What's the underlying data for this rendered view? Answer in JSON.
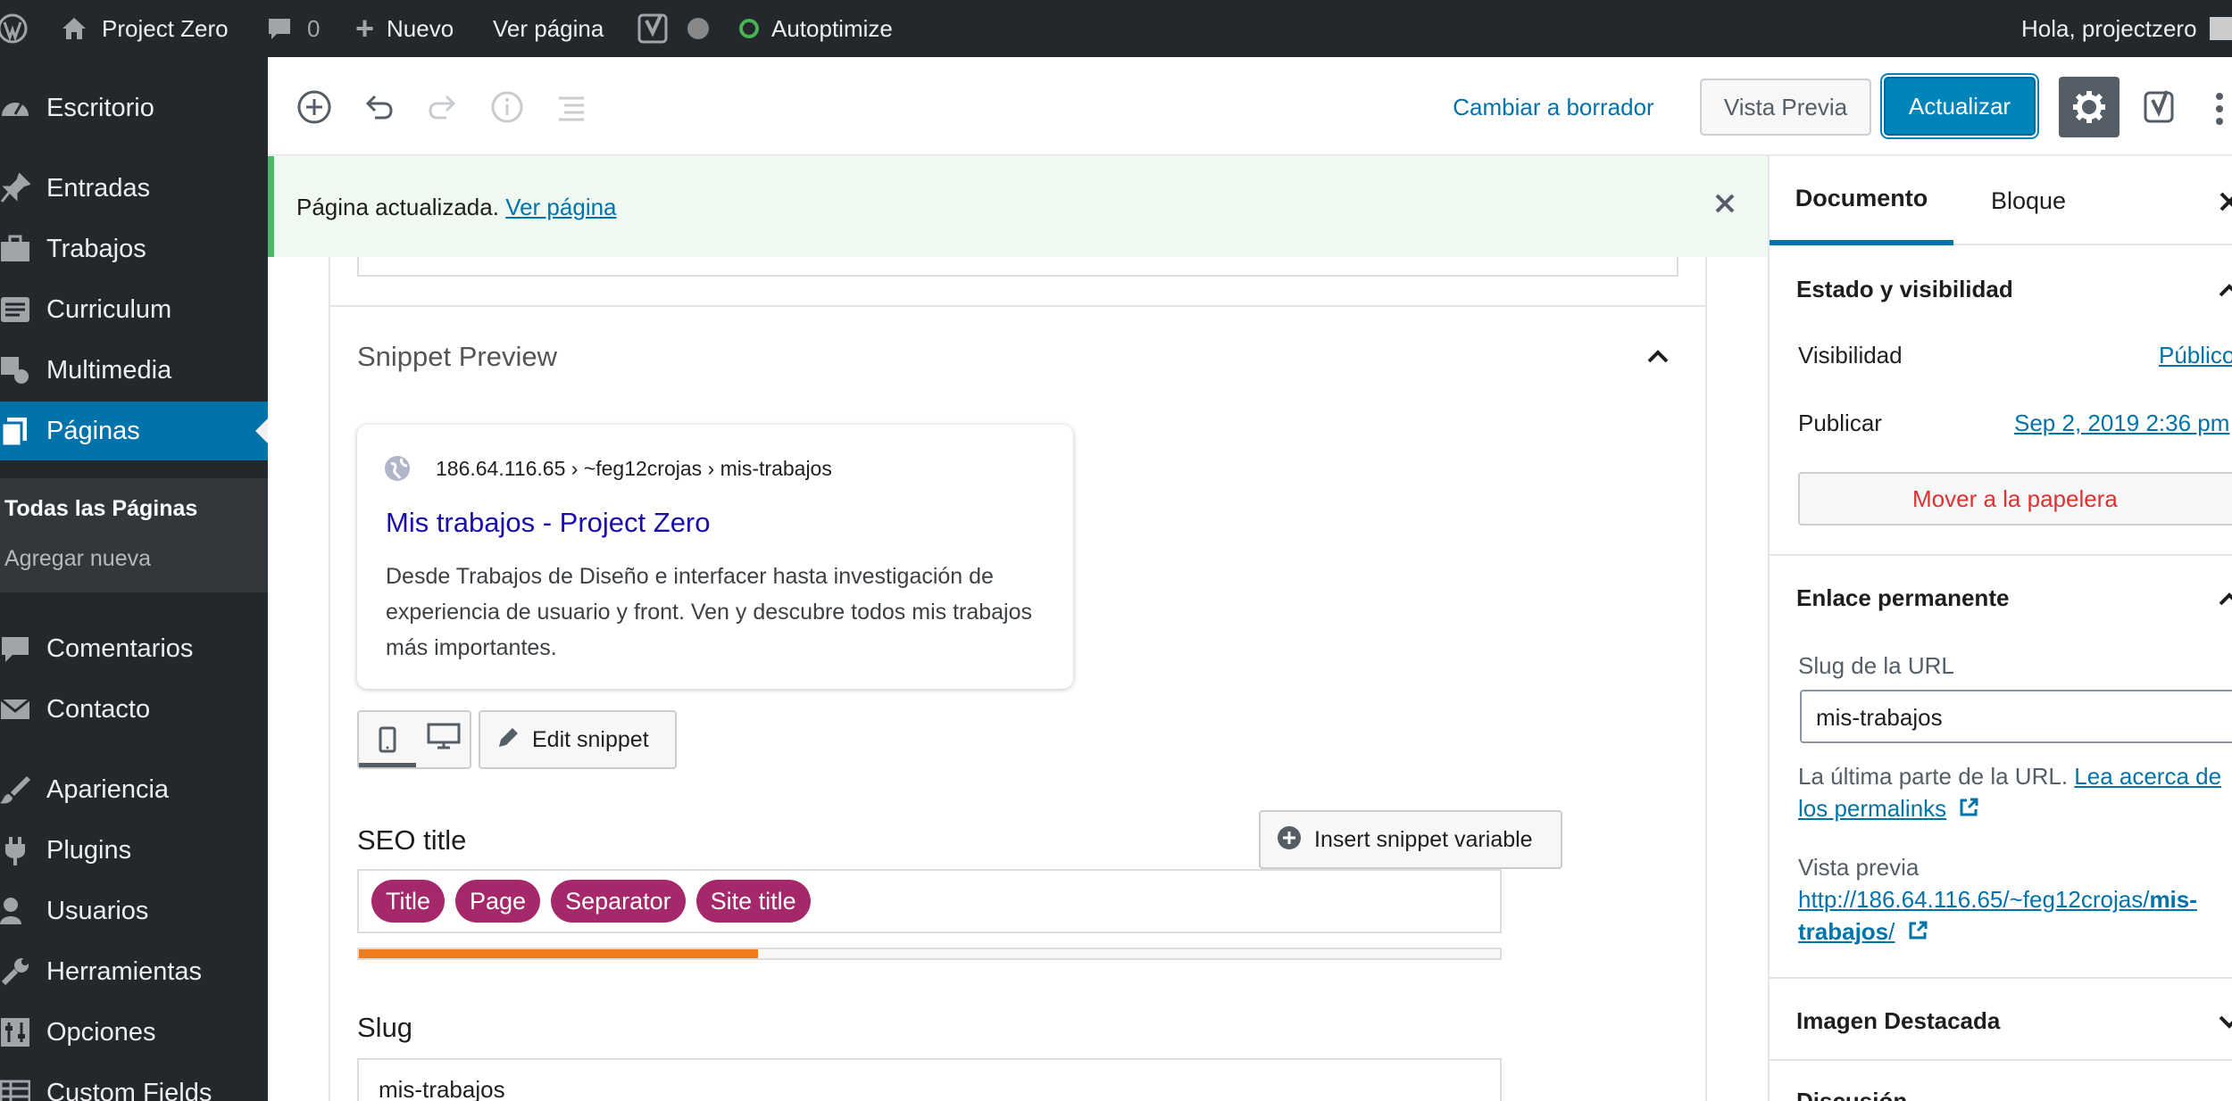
{
  "admin_bar": {
    "site_name": "Project Zero",
    "comments_count": "0",
    "new_label": "Nuevo",
    "view_page_label": "Ver página",
    "autoptimize_label": "Autoptimize",
    "greeting": "Hola, projectzero"
  },
  "menu": {
    "items": [
      {
        "label": "Escritorio",
        "icon": "dashboard-icon"
      },
      {
        "label": "Entradas",
        "icon": "pin-icon"
      },
      {
        "label": "Trabajos",
        "icon": "briefcase-icon"
      },
      {
        "label": "Curriculum",
        "icon": "document-lines-icon"
      },
      {
        "label": "Multimedia",
        "icon": "media-icon"
      },
      {
        "label": "Páginas",
        "icon": "pages-icon"
      },
      {
        "label": "Comentarios",
        "icon": "comment-icon"
      },
      {
        "label": "Contacto",
        "icon": "mail-icon"
      },
      {
        "label": "Apariencia",
        "icon": "brush-icon"
      },
      {
        "label": "Plugins",
        "icon": "plug-icon"
      },
      {
        "label": "Usuarios",
        "icon": "user-icon"
      },
      {
        "label": "Herramientas",
        "icon": "wrench-icon"
      },
      {
        "label": "Opciones",
        "icon": "settings-sliders-icon"
      },
      {
        "label": "Custom Fields",
        "icon": "table-icon"
      }
    ],
    "submenu": {
      "all_pages": "Todas las Páginas",
      "add_new": "Agregar nueva"
    }
  },
  "header": {
    "switch_to_draft": "Cambiar a borrador",
    "preview": "Vista Previa",
    "update": "Actualizar"
  },
  "notice": {
    "text": "Página actualizada.",
    "link": "Ver página"
  },
  "snippet": {
    "section_title": "Snippet Preview",
    "breadcrumb": "186.64.116.65 › ~feg12crojas › mis-trabajos",
    "title": "Mis trabajos - Project Zero",
    "description": "Desde Trabajos de Diseño e interfacer hasta investigación de experiencia de usuario y front. Ven y descubre todos mis trabajos más importantes.",
    "edit_snippet": "Edit snippet",
    "seo_title_label": "SEO title",
    "insert_variable": "Insert snippet variable",
    "variables": [
      "Title",
      "Page",
      "Separator",
      "Site title"
    ],
    "title_progress": 0.35,
    "progress_color": "#ee7c1b",
    "slug_label": "Slug",
    "slug_value": "mis-trabajos"
  },
  "sidebar": {
    "tabs": [
      "Documento",
      "Bloque"
    ],
    "status_title": "Estado y visibilidad",
    "visibility_label": "Visibilidad",
    "visibility_value": "Público",
    "publish_label": "Publicar",
    "publish_value": "Sep 2, 2019 2:36 pm",
    "trash": "Mover a la papelera",
    "permalink_title": "Enlace permanente",
    "slug_label": "Slug de la URL",
    "slug_value": "mis-trabajos",
    "help_text": "La última parte de la URL.",
    "help_link_1": "Lea acerca de",
    "help_link_2": "los permalinks",
    "preview_label": "Vista previa",
    "preview_url_1": "http://186.64.116.65/~feg12crojas/",
    "preview_url_bold_1": "mis-",
    "preview_url_bold_2": "trabajos",
    "preview_url_2": "/",
    "featured_title": "Imagen Destacada",
    "discussion_title": "Discusión"
  },
  "colors": {
    "admin_dark": "#23282d",
    "accent_blue": "#0073aa",
    "yoast_purple": "#a4286a",
    "trash_red": "#dc3232",
    "notice_green": "#4ab866"
  }
}
